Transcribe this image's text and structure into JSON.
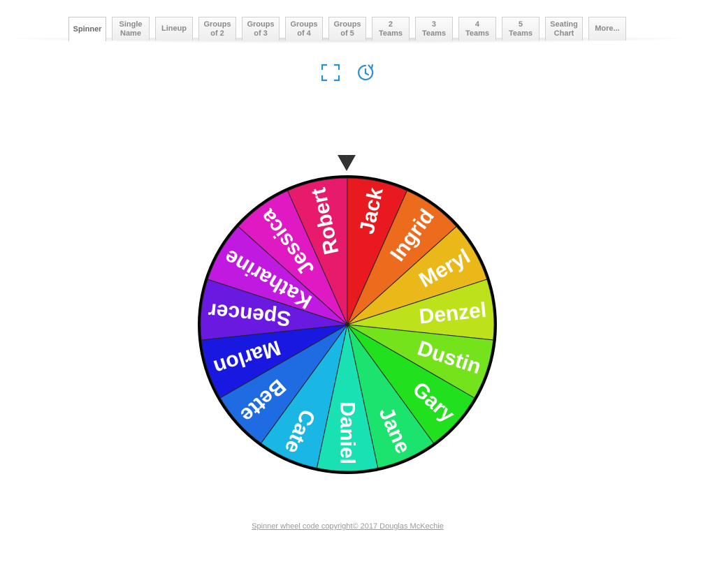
{
  "tabs": [
    {
      "label": "Spinner",
      "active": true
    },
    {
      "label": "Single\nName",
      "active": false
    },
    {
      "label": "Lineup",
      "active": false
    },
    {
      "label": "Groups\nof 2",
      "active": false
    },
    {
      "label": "Groups\nof 3",
      "active": false
    },
    {
      "label": "Groups\nof 4",
      "active": false
    },
    {
      "label": "Groups\nof 5",
      "active": false
    },
    {
      "label": "2\nTeams",
      "active": false
    },
    {
      "label": "3\nTeams",
      "active": false
    },
    {
      "label": "4\nTeams",
      "active": false
    },
    {
      "label": "5\nTeams",
      "active": false
    },
    {
      "label": "Seating\nChart",
      "active": false
    },
    {
      "label": "More...",
      "active": false
    }
  ],
  "toolbar": {
    "icons": [
      "fullscreen-icon",
      "timer-icon"
    ],
    "icon_color": "#2b8fd8"
  },
  "wheel": {
    "pointer_color": "#333333",
    "start_angle_deg": 0,
    "segments": [
      {
        "name": "Jack",
        "color": "#e8191f"
      },
      {
        "name": "Ingrid",
        "color": "#ec6b1d"
      },
      {
        "name": "Meryl",
        "color": "#eab919"
      },
      {
        "name": "Denzel",
        "color": "#bde21b"
      },
      {
        "name": "Dustin",
        "color": "#74e31b"
      },
      {
        "name": "Gary",
        "color": "#21e01e"
      },
      {
        "name": "Jane",
        "color": "#1ce36e"
      },
      {
        "name": "Daniel",
        "color": "#1ae1b4"
      },
      {
        "name": "Cate",
        "color": "#1ab7e4"
      },
      {
        "name": "Bette",
        "color": "#1e6be2"
      },
      {
        "name": "Marlon",
        "color": "#1818e0"
      },
      {
        "name": "Spencer",
        "color": "#6a1ae0"
      },
      {
        "name": "Katharine",
        "color": "#c01ae0"
      },
      {
        "name": "Jessica",
        "color": "#e01ac2"
      },
      {
        "name": "Robert",
        "color": "#e81a6c"
      }
    ]
  },
  "footer": {
    "text": "Spinner wheel code copyright© 2017 Douglas McKechie"
  }
}
